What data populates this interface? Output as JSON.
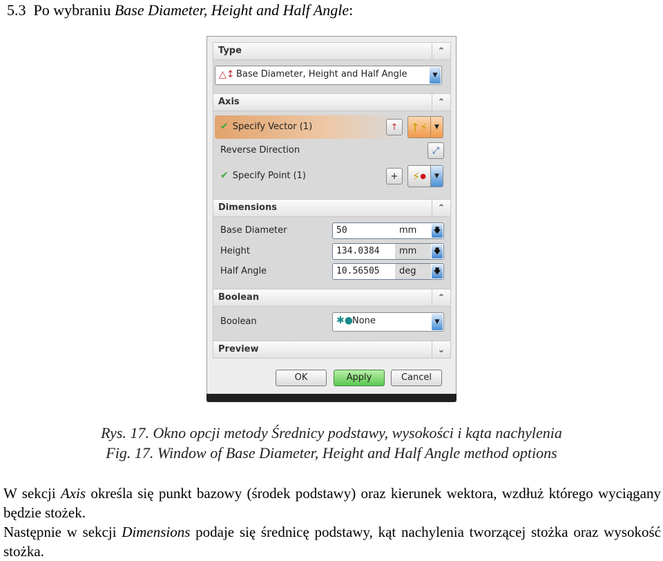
{
  "heading": {
    "number": "5.3",
    "prefix": "Po wybraniu ",
    "italic": "Base Diameter, Height and Half Angle",
    "suffix": ":"
  },
  "dialog": {
    "sections": {
      "type": {
        "title": "Type",
        "value": "Base Diameter, Height and Half Angle",
        "icon": "cone-icon"
      },
      "axis": {
        "title": "Axis",
        "specify_vector": "Specify Vector (1)",
        "reverse_direction": "Reverse Direction",
        "specify_point": "Specify Point (1)"
      },
      "dimensions": {
        "title": "Dimensions",
        "rows": [
          {
            "label": "Base Diameter",
            "value": "50",
            "unit": "mm"
          },
          {
            "label": "Height",
            "value": "134.0384",
            "unit": "mm"
          },
          {
            "label": "Half Angle",
            "value": "10.56505",
            "unit": "deg"
          }
        ]
      },
      "boolean": {
        "title": "Boolean",
        "label": "Boolean",
        "value": "None"
      },
      "preview": {
        "title": "Preview"
      }
    },
    "buttons": {
      "ok": "OK",
      "apply": "Apply",
      "cancel": "Cancel"
    },
    "colors": {
      "vector_highlight": "#e2a36c",
      "apply_green": "#5cc850",
      "dropdown_blue": "#4a8fd6",
      "check_green": "#3cab3c"
    }
  },
  "captions": {
    "pl": "Rys. 17. Okno opcji metody Średnicy podstawy, wysokości i kąta nachylenia",
    "en": "Fig. 17. Window of Base Diameter, Height and Half Angle method options"
  },
  "paragraphs": {
    "p1_a": "W sekcji ",
    "p1_italic": "Axis",
    "p1_b": " określa się punkt bazowy (środek podstawy) oraz kierunek wektora, wzdłuż którego wyciągany będzie stożek.",
    "p2_a": "Następnie w sekcji ",
    "p2_italic": "Dimensions",
    "p2_b": " podaje się średnicę podstawy, kąt nachylenia tworzącej stożka oraz wysokość stożka."
  }
}
